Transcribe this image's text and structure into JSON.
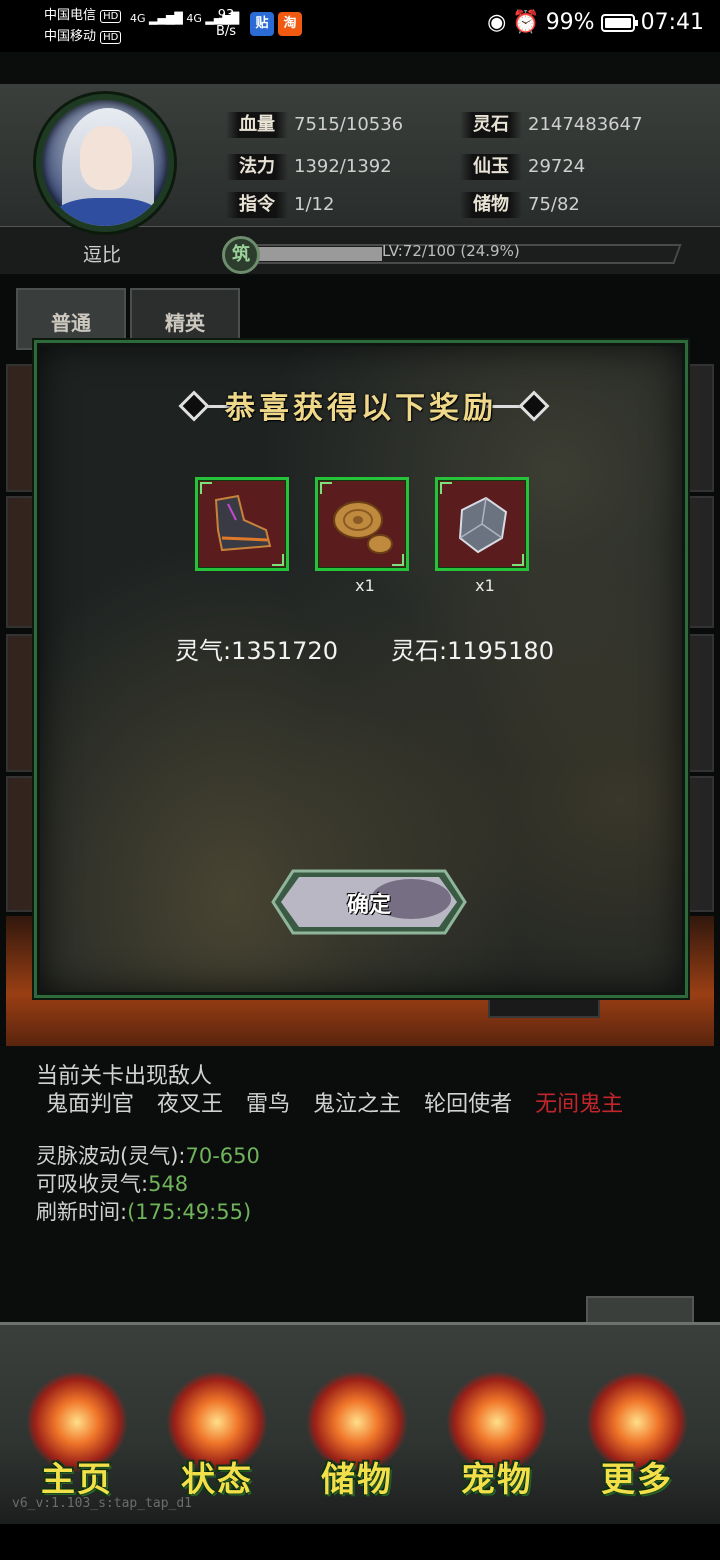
{
  "status_bar": {
    "carrier1": "中国电信",
    "carrier2": "中国移动",
    "hd": "HD",
    "net": "4G",
    "speed_value": "93",
    "speed_unit": "B/s",
    "battery": "99%",
    "time": "07:41"
  },
  "player": {
    "name": "逗比",
    "stats": [
      {
        "label": "血量",
        "value": "7515/10536"
      },
      {
        "label": "灵石",
        "value": "2147483647"
      },
      {
        "label": "法力",
        "value": "1392/1392"
      },
      {
        "label": "仙玉",
        "value": "29724"
      },
      {
        "label": "指令",
        "value": "1/12"
      },
      {
        "label": "储物",
        "value": "75/82"
      }
    ],
    "level_badge": "筑",
    "level_text": "LV:72/100 (24.9%)",
    "level_progress": 0.249
  },
  "tabs": [
    {
      "label": "普通"
    },
    {
      "label": "精英"
    }
  ],
  "modal": {
    "title": "恭喜获得以下奖励",
    "rewards": [
      {
        "icon": "boots-icon",
        "qty": ""
      },
      {
        "icon": "wood-log-icon",
        "qty": "x1"
      },
      {
        "icon": "ore-stone-icon",
        "qty": "x1"
      }
    ],
    "gain_lingqi": "灵气:1351720",
    "gain_lingshi": "灵石:1195180",
    "confirm_label": "确定"
  },
  "stage_info": {
    "enemy_title": "当前关卡出现敌人",
    "enemies": [
      "鬼面判官",
      "夜叉王",
      "雷鸟",
      "鬼泣之主",
      "轮回使者"
    ],
    "boss": "无间鬼主",
    "line1_label": "灵脉波动(灵气):",
    "line1_value": "70-650",
    "line2_label": "可吸收灵气:",
    "line2_value": "548",
    "line3_label": "刷新时间:",
    "line3_value": "(175:49:55)"
  },
  "nav": [
    {
      "label": "主页",
      "icon": "home-emblem-icon"
    },
    {
      "label": "状态",
      "icon": "status-emblem-icon"
    },
    {
      "label": "储物",
      "icon": "storage-emblem-icon"
    },
    {
      "label": "宠物",
      "icon": "phoenix-emblem-icon"
    },
    {
      "label": "更多",
      "icon": "more-emblem-icon"
    }
  ],
  "version": "v6_v:1.103_s:tap_tap_d1"
}
